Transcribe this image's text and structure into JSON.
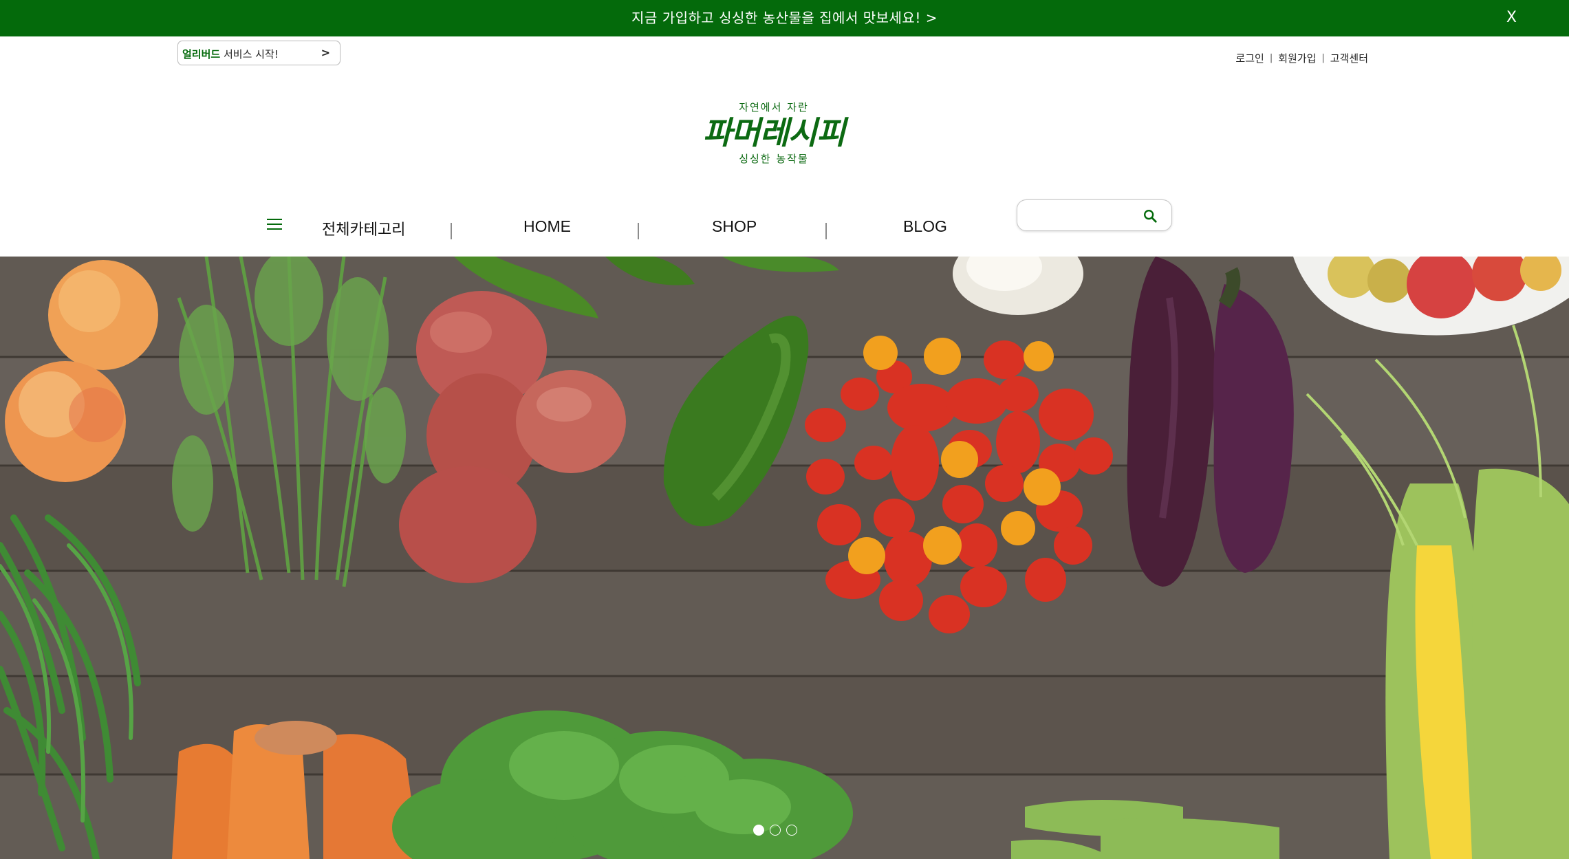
{
  "promo": {
    "text": "지금 가입하고 싱싱한 농산물을 집에서 맛보세요! >",
    "close_label": "X",
    "bg_color": "#046a0b"
  },
  "earlybird": {
    "strong": "얼리버드",
    "rest": " 서비스 시작!",
    "arrow": ">"
  },
  "util_links": [
    "로그인",
    "회원가입",
    "고객센터"
  ],
  "util_separator": "|",
  "logo": {
    "top_text": "자연에서 자란",
    "main_text": "파머레시피",
    "bottom_text": "싱싱한 농작물",
    "color": "#0c6a12"
  },
  "nav": {
    "menu_icon": "hamburger-icon",
    "items": [
      "전체카테고리",
      "HOME",
      "SHOP",
      "BLOG"
    ],
    "separator": "|",
    "search_placeholder": "",
    "search_icon": "search-icon"
  },
  "hero": {
    "slide_count": 3,
    "active_slide": 1,
    "description_icon": "vegetables-photo"
  }
}
